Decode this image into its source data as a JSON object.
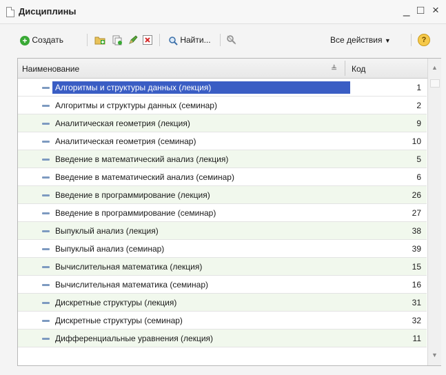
{
  "window": {
    "title": "Дисциплины",
    "minimize": "_",
    "maximize": "□",
    "close": "×"
  },
  "toolbar": {
    "create_label": "Создать",
    "find_label": "Найти...",
    "all_actions_label": "Все действия",
    "help_label": "?"
  },
  "columns": {
    "name": "Наименование",
    "code": "Код"
  },
  "rows": [
    {
      "name": "Алгоритмы и структуры данных (лекция)",
      "code": "1"
    },
    {
      "name": "Алгоритмы и структуры данных (семинар)",
      "code": "2"
    },
    {
      "name": "Аналитическая геометрия (лекция)",
      "code": "9"
    },
    {
      "name": "Аналитическая геометрия (семинар)",
      "code": "10"
    },
    {
      "name": "Введение в математический анализ (лекция)",
      "code": "5"
    },
    {
      "name": "Введение в математический анализ (семинар)",
      "code": "6"
    },
    {
      "name": "Введение в программирование (лекция)",
      "code": "26"
    },
    {
      "name": "Введение в программирование (семинар)",
      "code": "27"
    },
    {
      "name": "Выпуклый анализ (лекция)",
      "code": "38"
    },
    {
      "name": "Выпуклый анализ (семинар)",
      "code": "39"
    },
    {
      "name": "Вычислительная математика (лекция)",
      "code": "15"
    },
    {
      "name": "Вычислительная математика (семинар)",
      "code": "16"
    },
    {
      "name": "Дискретные структуры (лекция)",
      "code": "31"
    },
    {
      "name": "Дискретные структуры (семинар)",
      "code": "32"
    },
    {
      "name": "Дифференциальные уравнения (лекция)",
      "code": "11"
    }
  ],
  "colors": {
    "selection": "#3a5dc4",
    "alt_row": "#f1f8ed",
    "create_icon": "#39a935"
  }
}
